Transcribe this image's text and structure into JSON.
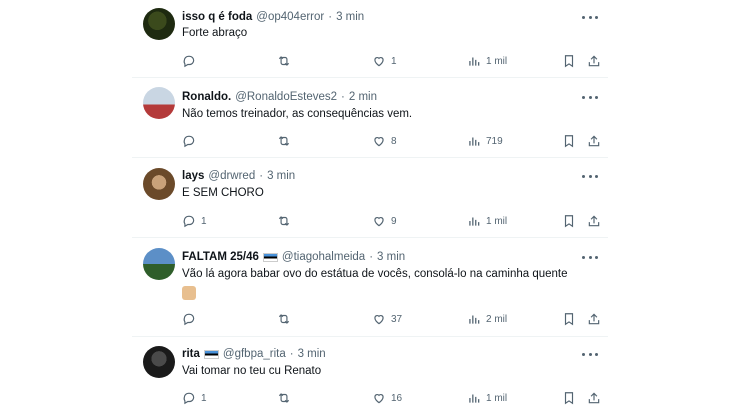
{
  "tweets": [
    {
      "name": "isso q é foda",
      "handle": "@op404error",
      "sep": "·",
      "time": "3 min",
      "text": "Forte abraço",
      "has_flag": false,
      "avatar_colors": [
        "#1e2a10",
        "#3b4a1c"
      ],
      "replies": "",
      "retweets": "",
      "likes": "1",
      "views": "1 mil"
    },
    {
      "name": "Ronaldo.",
      "handle": "@RonaldoEsteves2",
      "sep": "·",
      "time": "2 min",
      "text": "Não temos treinador, as consequências vem.",
      "has_flag": false,
      "avatar_colors": [
        "#c9d6e3",
        "#b43a3a"
      ],
      "replies": "",
      "retweets": "",
      "likes": "8",
      "views": "719"
    },
    {
      "name": "lays",
      "handle": "@drwred",
      "sep": "·",
      "time": "3 min",
      "text": "E SEM CHORO",
      "has_flag": false,
      "avatar_colors": [
        "#6b4a2a",
        "#c9a27a"
      ],
      "replies": "1",
      "retweets": "",
      "likes": "9",
      "views": "1 mil"
    },
    {
      "name": "FALTAM 25/46",
      "handle": "@tiagohalmeida",
      "sep": "·",
      "time": "3 min",
      "text": "Vão lá agora babar ovo do estátua de vocês, consolá-lo na caminha quente",
      "has_flag": true,
      "avatar_colors": [
        "#5c8fc7",
        "#2f5e2a"
      ],
      "replies": "",
      "retweets": "",
      "likes": "37",
      "views": "2 mil"
    },
    {
      "name": "rita",
      "handle": "@gfbpa_rita",
      "sep": "·",
      "time": "3 min",
      "text": "Vai tomar no teu cu Renato",
      "has_flag": true,
      "avatar_colors": [
        "#1a1a1a",
        "#4a4a4a"
      ],
      "replies": "1",
      "retweets": "",
      "likes": "16",
      "views": "1 mil"
    }
  ],
  "icons": {
    "more": "more-icon",
    "reply": "reply-icon",
    "retweet": "retweet-icon",
    "like": "heart-icon",
    "views": "views-icon",
    "bookmark": "bookmark-icon",
    "share": "share-icon"
  },
  "colors": {
    "text": "#0f1419",
    "muted": "#536471",
    "divider": "#eff3f4"
  }
}
